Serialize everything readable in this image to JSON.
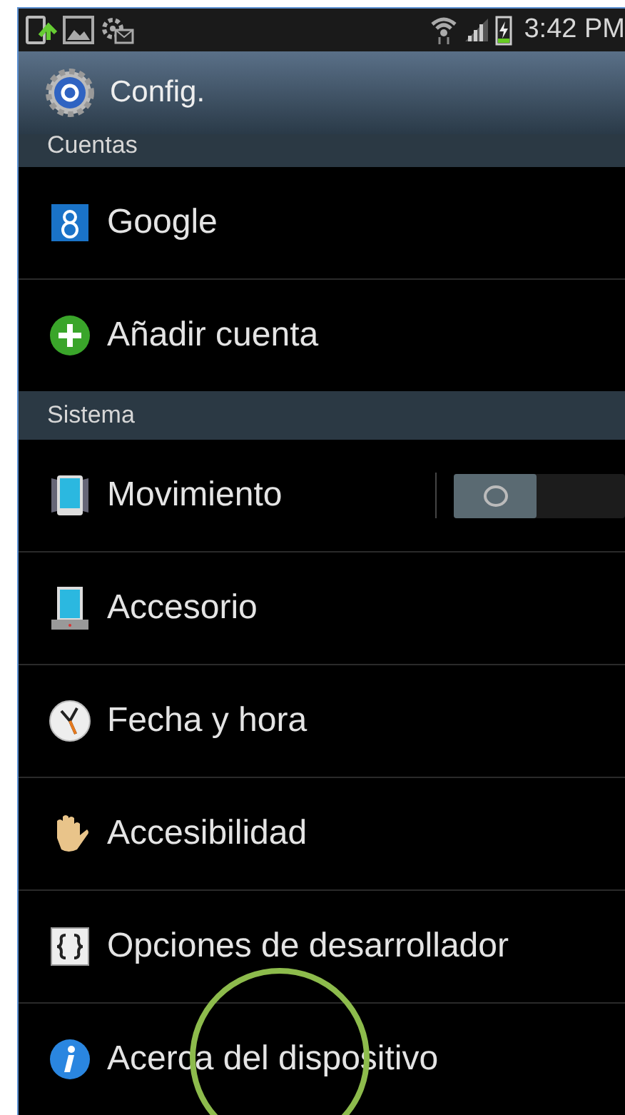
{
  "status_bar": {
    "time": "3:42 PM"
  },
  "action_bar": {
    "title": "Config."
  },
  "sections": [
    {
      "header": "Cuentas",
      "items": [
        {
          "kind": "plain",
          "label": "Google"
        },
        {
          "kind": "plain",
          "label": "Añadir cuenta"
        }
      ]
    },
    {
      "header": "Sistema",
      "items": [
        {
          "kind": "toggle",
          "label": "Movimiento",
          "on": false
        },
        {
          "kind": "plain",
          "label": "Accesorio"
        },
        {
          "kind": "plain",
          "label": "Fecha y hora"
        },
        {
          "kind": "plain",
          "label": "Accesibilidad"
        },
        {
          "kind": "plain",
          "label": "Opciones de desarrollador"
        },
        {
          "kind": "plain",
          "label": "Acerca del dispositivo"
        }
      ]
    }
  ]
}
